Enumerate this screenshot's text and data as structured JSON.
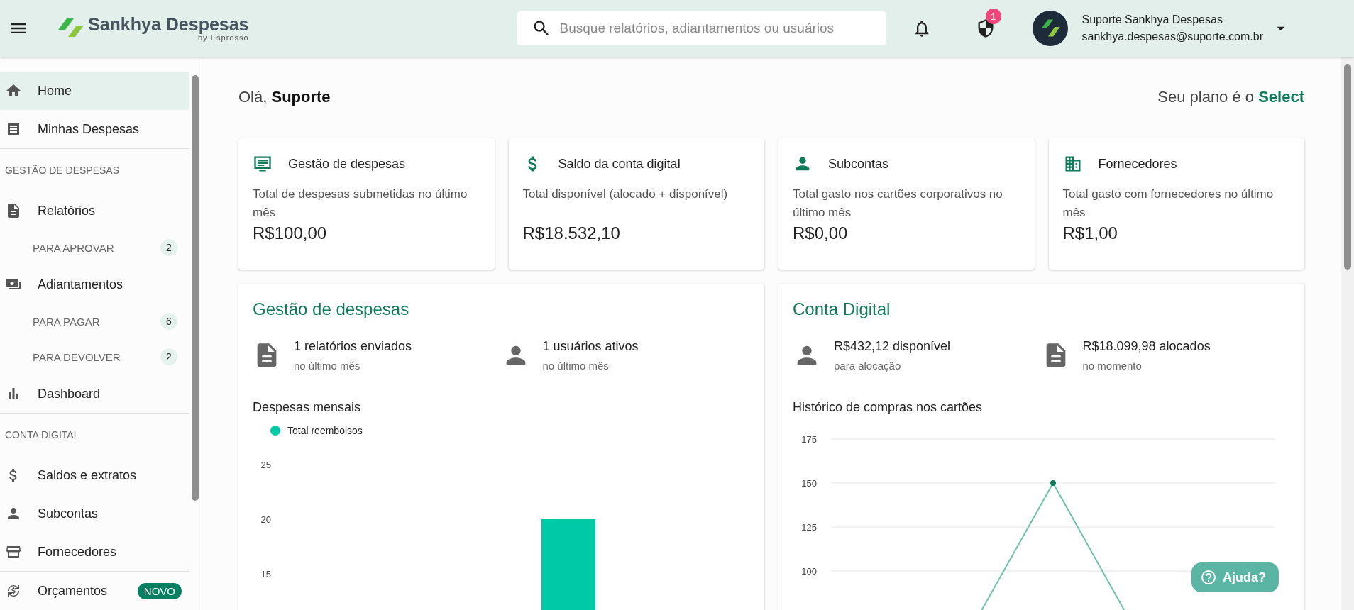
{
  "header": {
    "brand": "Sankhya Despesas",
    "byline": "by Espresso",
    "search": {
      "placeholder": "Busque relatórios, adiantamentos ou usuários"
    },
    "shield_badge": "1",
    "user": {
      "name": "Suporte Sankhya Despesas",
      "email": "sankhya.despesas@suporte.com.br"
    }
  },
  "sidebar": {
    "items": [
      {
        "kind": "item",
        "label": "Home",
        "selected": true
      },
      {
        "kind": "item",
        "label": "Minhas Despesas",
        "selected": false
      },
      {
        "kind": "divider"
      },
      {
        "kind": "section",
        "label": "GESTÃO DE DESPESAS"
      },
      {
        "kind": "item",
        "label": "Relatórios",
        "selected": false
      },
      {
        "kind": "sub",
        "label": "PARA APROVAR",
        "badge": "2",
        "selected": false
      },
      {
        "kind": "item",
        "label": "Adiantamentos",
        "selected": false
      },
      {
        "kind": "sub",
        "label": "PARA PAGAR",
        "badge": "6",
        "selected": false
      },
      {
        "kind": "sub",
        "label": "PARA DEVOLVER",
        "badge": "2",
        "selected": false
      },
      {
        "kind": "item",
        "label": "Dashboard",
        "selected": false
      },
      {
        "kind": "divider"
      },
      {
        "kind": "section",
        "label": "CONTA DIGITAL"
      },
      {
        "kind": "item",
        "label": "Saldos e extratos",
        "selected": false
      },
      {
        "kind": "item",
        "label": "Subcontas",
        "selected": false
      },
      {
        "kind": "item",
        "label": "Fornecedores",
        "selected": false
      },
      {
        "kind": "divider"
      },
      {
        "kind": "item",
        "label": "Orçamentos",
        "tag": "NOVO",
        "selected": false
      }
    ]
  },
  "greeting": "Olá, **Suporte**",
  "plan": "Seu plano é o **Select**",
  "cards": [
    {
      "title": "Gestão de despesas",
      "description": "Total de despesas submetidas no último mês",
      "value": "R$100,00"
    },
    {
      "title": "Saldo da conta digital",
      "description": "Total disponível (alocado + disponível)",
      "value": "R$18.532,10"
    },
    {
      "title": "Subcontas",
      "description": "Total gasto nos cartões corporativos no último mês",
      "value": "R$0,00"
    },
    {
      "title": "Fornecedores",
      "description": "Total gasto com fornecedores no último mês",
      "value": "R$1,00"
    }
  ],
  "panels": [
    {
      "title": "Gestão de despesas",
      "stats": [
        {
          "value": "1 relatórios enviados",
          "caption": "no último mês"
        },
        {
          "value": "1 usuários ativos",
          "caption": "no último mês"
        }
      ],
      "chart_title": "Despesas mensais",
      "chart": {
        "kind": "bar",
        "legend": "Total reembolsos",
        "y_labels": [
          "25",
          "20",
          "15"
        ]
      }
    },
    {
      "title": "Conta Digital",
      "stats": [
        {
          "value": "R$432,12 disponível",
          "caption": "para alocação"
        },
        {
          "value": "R$18.099,98 alocados",
          "caption": "no momento"
        }
      ],
      "chart_title": "Histórico de compras nos cartões",
      "chart": {
        "kind": "line",
        "y_labels": [
          "175",
          "150",
          "125",
          "100"
        ]
      }
    }
  ],
  "help_button": "Ajuda?"
}
